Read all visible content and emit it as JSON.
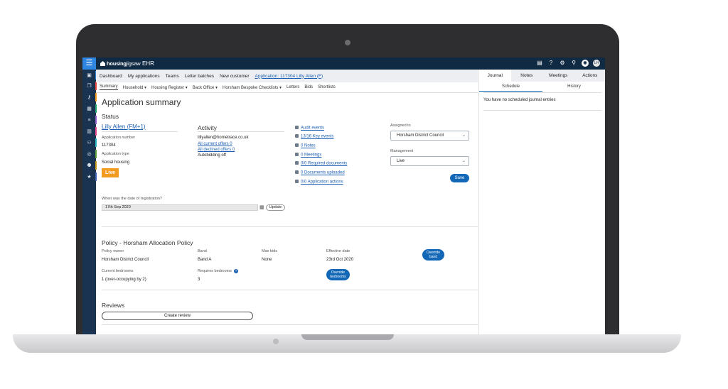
{
  "app": {
    "brand_bold": "housing",
    "brand_light": "jigsaw",
    "product": "EHR"
  },
  "topbar": {
    "icons": [
      "document-icon",
      "help-icon",
      "gear-icon",
      "search-icon",
      "user-circle-icon",
      "profile-icon"
    ],
    "profile_initials": "LH"
  },
  "sidebar": {
    "items": [
      {
        "icon": "dashboard-icon",
        "color": "#2f86e0"
      },
      {
        "icon": "layers-icon",
        "color": "#e8493c"
      },
      {
        "icon": "key-icon",
        "color": "#f39a21"
      },
      {
        "icon": "id-card-icon",
        "color": "#1fa36b"
      },
      {
        "icon": "list-icon",
        "color": "#8f5ec7"
      },
      {
        "icon": "building-icon",
        "color": "#e54b8a"
      },
      {
        "icon": "people-icon",
        "color": "#2bb3c0"
      },
      {
        "icon": "target-icon",
        "color": "#5e9f3c"
      },
      {
        "icon": "team-icon",
        "color": "#c99a1d"
      },
      {
        "icon": "star-icon",
        "color": "#3d5fb8"
      }
    ]
  },
  "nav_primary": {
    "items": [
      "Dashboard",
      "My applications",
      "Teams",
      "Letter batches",
      "New customer"
    ],
    "current_link": "Application: 117304 Lilly Allen (F)"
  },
  "nav_secondary": {
    "items": [
      "Summary",
      "Household ▾",
      "Housing Register ▾",
      "Back Office ▾",
      "Horsham Bespoke Checklists ▾",
      "Letters",
      "Bids",
      "Shortlists"
    ]
  },
  "summary": {
    "title": "Application summary",
    "status_heading": "Status",
    "applicant_name": "Lilly Allen (FM+1)",
    "app_number_label": "Application number",
    "app_number": "117304",
    "app_type_label": "Application type",
    "app_type": "Social housing",
    "status_badge": "Live",
    "activity_heading": "Activity",
    "email": "lillyallen@hometrace.co.uk",
    "current_offers": "All current offers 0",
    "declined_offers": "All declined offers 0",
    "autobidding": "Autobidding off"
  },
  "quick_links": [
    {
      "icon": "clock-icon",
      "label": "Audit events"
    },
    {
      "icon": "key-icon",
      "label": "13/16 Key events"
    },
    {
      "icon": "folder-icon",
      "label": "0 Notes"
    },
    {
      "icon": "calendar-icon",
      "label": "0 Meetings"
    },
    {
      "icon": "file-icon",
      "label": "0/0 Required documents"
    },
    {
      "icon": "file-icon",
      "label": "0 Documents uploaded"
    },
    {
      "icon": "users-icon",
      "label": "0/0 Application actions"
    }
  ],
  "assignment": {
    "assigned_label": "Assigned to",
    "assigned_value": "Horsham District Council",
    "management_label": "Management",
    "management_value": "Live",
    "save_label": "Save"
  },
  "registration": {
    "question": "When was the date of registration?",
    "date": "17th Sep 2020",
    "update_label": "Update"
  },
  "policy": {
    "heading": "Policy - Horsham Allocation Policy",
    "owner_label": "Policy owner",
    "owner": "Horsham District Council",
    "band_label": "Band",
    "band": "Band A",
    "max_bids_label": "Max bids",
    "max_bids": "None",
    "effective_label": "Effective date",
    "effective": "23rd Oct 2020",
    "override_band": "Override band",
    "current_bedrooms_label": "Current bedrooms",
    "current_bedrooms": "1 (over-occupying by 2)",
    "requires_bedrooms_label": "Requires bedrooms",
    "requires_bedrooms": "3",
    "override_bedrooms": "Override bedrooms"
  },
  "reviews": {
    "heading": "Reviews",
    "create_label": "Create review"
  },
  "right_panel": {
    "tabs": [
      "Journal",
      "Notes",
      "Meetings",
      "Actions"
    ],
    "subtabs": [
      "Schedule",
      "History"
    ],
    "empty_text": "You have no scheduled journal entries"
  }
}
